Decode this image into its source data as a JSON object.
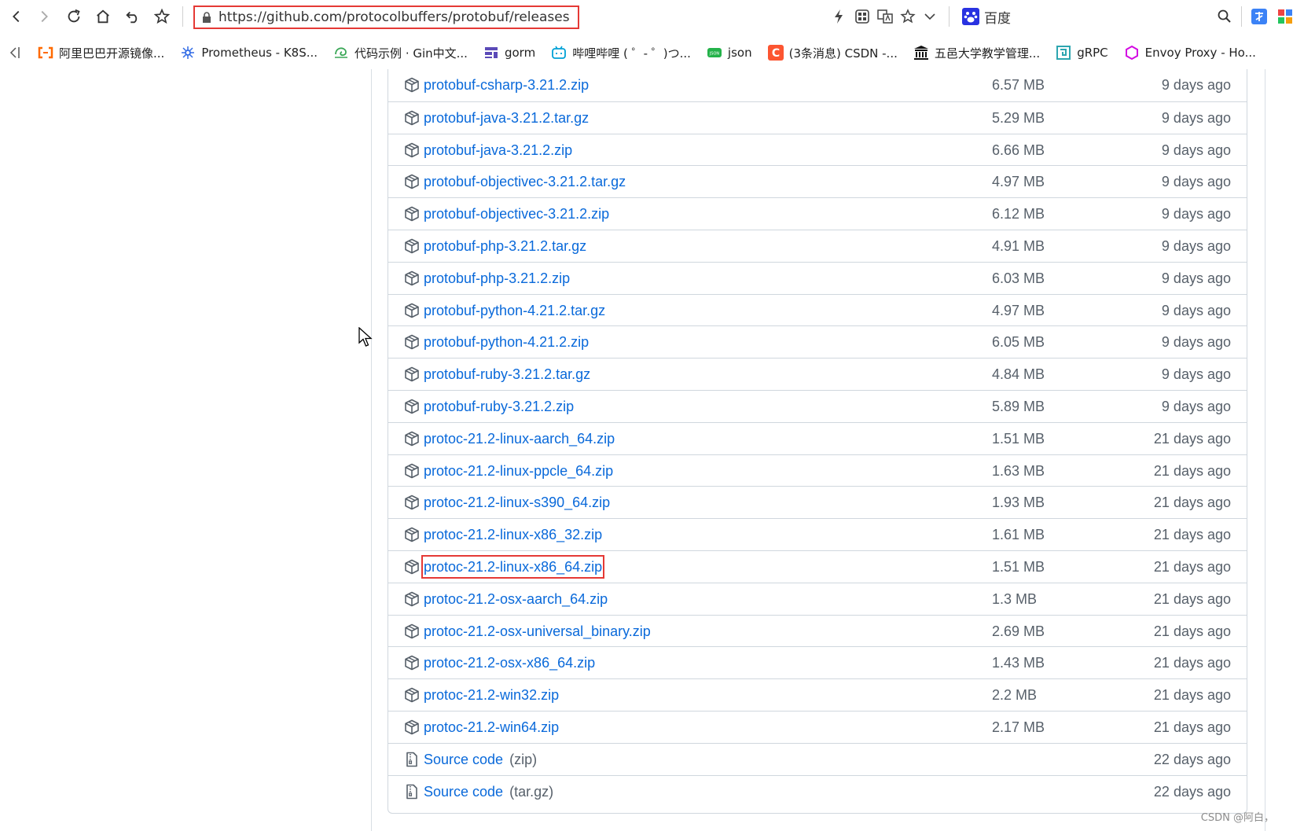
{
  "browser": {
    "url": "https://github.com/protocolbuffers/protobuf/releases",
    "search_engine_label": "百度"
  },
  "bookmarks": [
    {
      "label": "阿里巴巴开源镜像...",
      "icon": "aliyun-icon",
      "color": "#ff6a00"
    },
    {
      "label": "Prometheus - K8S...",
      "icon": "kubernetes-icon",
      "color": "#326ce5"
    },
    {
      "label": "代码示例 · Gin中文...",
      "icon": "gin-icon",
      "color": "#3aa757"
    },
    {
      "label": "gorm",
      "icon": "gorm-icon",
      "color": "#5b4ab8"
    },
    {
      "label": "哔哩哔哩 ( ゜- ゜)つ...",
      "icon": "bilibili-icon",
      "color": "#00a1d6"
    },
    {
      "label": "json",
      "icon": "json-icon",
      "color": "#24b24a"
    },
    {
      "label": "(3条消息) CSDN -...",
      "icon": "csdn-icon",
      "color": "#fc5531"
    },
    {
      "label": "五邑大学教学管理...",
      "icon": "university-icon",
      "color": "#111111"
    },
    {
      "label": "gRPC",
      "icon": "grpc-icon",
      "color": "#2da6b0"
    },
    {
      "label": "Envoy Proxy - Ho...",
      "icon": "envoy-icon",
      "color": "#d30ae2"
    }
  ],
  "assets": [
    {
      "name": "protobuf-csharp-3.21.2.zip",
      "size": "6.57 MB",
      "ago": "9 days ago"
    },
    {
      "name": "protobuf-java-3.21.2.tar.gz",
      "size": "5.29 MB",
      "ago": "9 days ago"
    },
    {
      "name": "protobuf-java-3.21.2.zip",
      "size": "6.66 MB",
      "ago": "9 days ago"
    },
    {
      "name": "protobuf-objectivec-3.21.2.tar.gz",
      "size": "4.97 MB",
      "ago": "9 days ago"
    },
    {
      "name": "protobuf-objectivec-3.21.2.zip",
      "size": "6.12 MB",
      "ago": "9 days ago"
    },
    {
      "name": "protobuf-php-3.21.2.tar.gz",
      "size": "4.91 MB",
      "ago": "9 days ago"
    },
    {
      "name": "protobuf-php-3.21.2.zip",
      "size": "6.03 MB",
      "ago": "9 days ago"
    },
    {
      "name": "protobuf-python-4.21.2.tar.gz",
      "size": "4.97 MB",
      "ago": "9 days ago"
    },
    {
      "name": "protobuf-python-4.21.2.zip",
      "size": "6.05 MB",
      "ago": "9 days ago"
    },
    {
      "name": "protobuf-ruby-3.21.2.tar.gz",
      "size": "4.84 MB",
      "ago": "9 days ago"
    },
    {
      "name": "protobuf-ruby-3.21.2.zip",
      "size": "5.89 MB",
      "ago": "9 days ago"
    },
    {
      "name": "protoc-21.2-linux-aarch_64.zip",
      "size": "1.51 MB",
      "ago": "21 days ago"
    },
    {
      "name": "protoc-21.2-linux-ppcle_64.zip",
      "size": "1.63 MB",
      "ago": "21 days ago"
    },
    {
      "name": "protoc-21.2-linux-s390_64.zip",
      "size": "1.93 MB",
      "ago": "21 days ago"
    },
    {
      "name": "protoc-21.2-linux-x86_32.zip",
      "size": "1.61 MB",
      "ago": "21 days ago"
    },
    {
      "name": "protoc-21.2-linux-x86_64.zip",
      "size": "1.51 MB",
      "ago": "21 days ago",
      "highlighted": true
    },
    {
      "name": "protoc-21.2-osx-aarch_64.zip",
      "size": "1.3 MB",
      "ago": "21 days ago"
    },
    {
      "name": "protoc-21.2-osx-universal_binary.zip",
      "size": "2.69 MB",
      "ago": "21 days ago"
    },
    {
      "name": "protoc-21.2-osx-x86_64.zip",
      "size": "1.43 MB",
      "ago": "21 days ago"
    },
    {
      "name": "protoc-21.2-win32.zip",
      "size": "2.2 MB",
      "ago": "21 days ago"
    },
    {
      "name": "protoc-21.2-win64.zip",
      "size": "2.17 MB",
      "ago": "21 days ago"
    },
    {
      "name": "Source code",
      "suffix": "(zip)",
      "size": "",
      "ago": "22 days ago",
      "source": true
    },
    {
      "name": "Source code",
      "suffix": "(tar.gz)",
      "size": "",
      "ago": "22 days ago",
      "source": true
    }
  ],
  "watermark": "CSDN @阿白，",
  "colors": {
    "link": "#0969da",
    "muted": "#57606a",
    "highlight": "#e53935",
    "border": "#d0d7de"
  }
}
